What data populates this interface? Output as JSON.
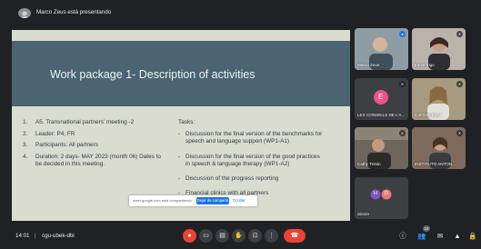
{
  "topbar": {
    "presenter_text": "Marco Zeus está presentando"
  },
  "slide": {
    "title": "Work package 1- Description of activities",
    "items": [
      {
        "num": "1.",
        "text": "A5. Transnational partners' meeting -2"
      },
      {
        "num": "2.",
        "text": "Leader: P4, FR"
      },
      {
        "num": "3.",
        "text": "Participants: All partners"
      },
      {
        "num": "4.",
        "text": "Duration: 2 days- MAY 2023 (month 06) Dates to be decided in this meeting."
      }
    ],
    "tasks_heading": "Tasks:",
    "tasks": [
      "Discussion for the final version of the benchmarks for speech and language support (WP1-A1)",
      "Discussion for the final version of the good practices in speech & language therapy (WP1-A2)",
      "Discussion of the progress reporting",
      "Financial clinics with all partners"
    ]
  },
  "share_bar": {
    "text": "meet.google.com está compartiendo ...",
    "stop_label": "Dejar de compartir",
    "hide_label": "Ocultar"
  },
  "participants": [
    {
      "name": "Marco Zeus",
      "mic": "active",
      "color": "#7a8b92"
    },
    {
      "name": "Iratxe Irigo",
      "mic": "muted",
      "color": "#6f5d55"
    },
    {
      "name": "LES CONSEILS DE L'A...",
      "mic": "muted",
      "avatar_letter": "E",
      "color": "#ef5187"
    },
    {
      "name": "Carmela Basu",
      "mic": "muted",
      "color": "#8a7f63"
    },
    {
      "name": "Cathy Tristin",
      "mic": "muted",
      "color": "#5d5248"
    },
    {
      "name": "INSTITUTO ANTON...",
      "mic": "muted",
      "color": "#6d5b50"
    },
    {
      "name": "Simón",
      "mic": "muted",
      "avatar_letters": [
        "H",
        "D"
      ],
      "color": "#3c4043"
    }
  ],
  "bottombar": {
    "time": "14:01",
    "divider": "|",
    "meeting_code": "cgu-ubek-dbi",
    "participant_count": "10"
  },
  "icons": {
    "mic": "mic-off-icon",
    "camera": "camera-off-icon",
    "captions": "captions-icon",
    "raise_hand": "raise-hand-icon",
    "present": "present-screen-icon",
    "more": "more-options-icon",
    "end_call": "end-call-icon",
    "info": "info-icon",
    "people": "people-icon",
    "chat": "chat-icon",
    "activities": "activities-icon",
    "lock": "host-controls-icon"
  },
  "colors": {
    "accent": "#1a73e8",
    "danger": "#ea4335",
    "background": "#202124",
    "slide_header": "#4a6472"
  }
}
